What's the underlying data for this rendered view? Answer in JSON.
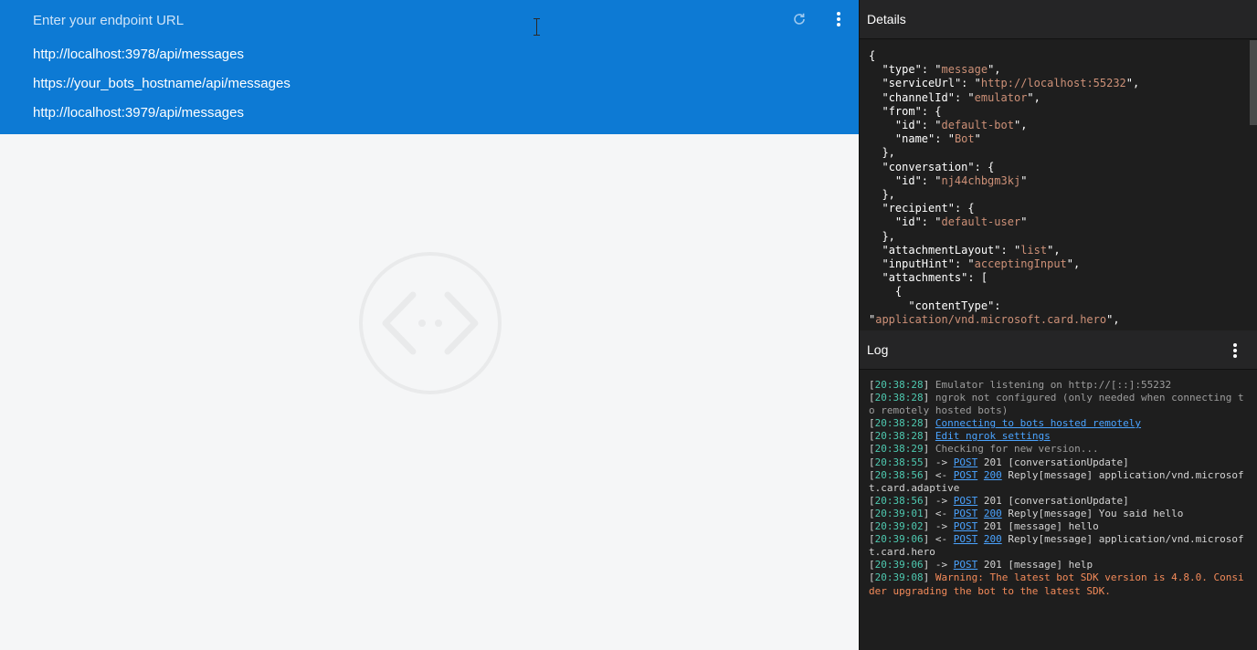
{
  "endpoint": {
    "placeholder": "Enter your endpoint URL",
    "suggestions": [
      "http://localhost:3978/api/messages",
      "https://your_bots_hostname/api/messages",
      "http://localhost:3979/api/messages"
    ]
  },
  "details": {
    "title": "Details",
    "json_lines": [
      [
        [
          "p",
          "{"
        ]
      ],
      [
        [
          "p",
          "  \""
        ],
        [
          "k",
          "type"
        ],
        [
          "p",
          "\": \""
        ],
        [
          "s",
          "message"
        ],
        [
          "p",
          "\","
        ]
      ],
      [
        [
          "p",
          "  \""
        ],
        [
          "k",
          "serviceUrl"
        ],
        [
          "p",
          "\": \""
        ],
        [
          "s",
          "http://localhost:55232"
        ],
        [
          "p",
          "\","
        ]
      ],
      [
        [
          "p",
          "  \""
        ],
        [
          "k",
          "channelId"
        ],
        [
          "p",
          "\": \""
        ],
        [
          "s",
          "emulator"
        ],
        [
          "p",
          "\","
        ]
      ],
      [
        [
          "p",
          "  \""
        ],
        [
          "k",
          "from"
        ],
        [
          "p",
          "\": {"
        ]
      ],
      [
        [
          "p",
          "    \""
        ],
        [
          "k",
          "id"
        ],
        [
          "p",
          "\": \""
        ],
        [
          "s",
          "default-bot"
        ],
        [
          "p",
          "\","
        ]
      ],
      [
        [
          "p",
          "    \""
        ],
        [
          "k",
          "name"
        ],
        [
          "p",
          "\": \""
        ],
        [
          "s",
          "Bot"
        ],
        [
          "p",
          "\""
        ]
      ],
      [
        [
          "p",
          "  },"
        ]
      ],
      [
        [
          "p",
          "  \""
        ],
        [
          "k",
          "conversation"
        ],
        [
          "p",
          "\": {"
        ]
      ],
      [
        [
          "p",
          "    \""
        ],
        [
          "k",
          "id"
        ],
        [
          "p",
          "\": \""
        ],
        [
          "s",
          "nj44chbgm3kj"
        ],
        [
          "p",
          "\""
        ]
      ],
      [
        [
          "p",
          "  },"
        ]
      ],
      [
        [
          "p",
          "  \""
        ],
        [
          "k",
          "recipient"
        ],
        [
          "p",
          "\": {"
        ]
      ],
      [
        [
          "p",
          "    \""
        ],
        [
          "k",
          "id"
        ],
        [
          "p",
          "\": \""
        ],
        [
          "s",
          "default-user"
        ],
        [
          "p",
          "\""
        ]
      ],
      [
        [
          "p",
          "  },"
        ]
      ],
      [
        [
          "p",
          "  \""
        ],
        [
          "k",
          "attachmentLayout"
        ],
        [
          "p",
          "\": \""
        ],
        [
          "s",
          "list"
        ],
        [
          "p",
          "\","
        ]
      ],
      [
        [
          "p",
          "  \""
        ],
        [
          "k",
          "inputHint"
        ],
        [
          "p",
          "\": \""
        ],
        [
          "s",
          "acceptingInput"
        ],
        [
          "p",
          "\","
        ]
      ],
      [
        [
          "p",
          "  \""
        ],
        [
          "k",
          "attachments"
        ],
        [
          "p",
          "\": ["
        ]
      ],
      [
        [
          "p",
          "    {"
        ]
      ],
      [
        [
          "p",
          "      \""
        ],
        [
          "k",
          "contentType"
        ],
        [
          "p",
          "\":"
        ]
      ],
      [
        [
          "p",
          "\""
        ],
        [
          "s",
          "application/vnd.microsoft.card.hero"
        ],
        [
          "p",
          "\","
        ]
      ]
    ]
  },
  "log": {
    "title": "Log",
    "entries": [
      {
        "time": "20:38:28",
        "parts": [
          [
            "dim",
            "Emulator listening on http://[::]:55232"
          ]
        ]
      },
      {
        "time": "20:38:28",
        "parts": [
          [
            "dim",
            "ngrok not configured (only needed when connecting to remotely hosted bots)"
          ]
        ]
      },
      {
        "time": "20:38:28",
        "parts": [
          [
            "lnk",
            "Connecting to bots hosted remotely"
          ]
        ]
      },
      {
        "time": "20:38:28",
        "parts": [
          [
            "lnk",
            "Edit ngrok settings"
          ]
        ]
      },
      {
        "time": "20:38:29",
        "parts": [
          [
            "dim",
            "Checking for new version..."
          ]
        ]
      },
      {
        "time": "20:38:55",
        "parts": [
          [
            "txt",
            "-> "
          ],
          [
            "lnk",
            "POST"
          ],
          [
            "txt",
            " 201 [conversationUpdate]"
          ]
        ]
      },
      {
        "time": "20:38:56",
        "parts": [
          [
            "txt",
            "<- "
          ],
          [
            "lnk",
            "POST"
          ],
          [
            "txt",
            " "
          ],
          [
            "lnk",
            "200"
          ],
          [
            "txt",
            " Reply[message] application/vnd.microsoft.card.adaptive"
          ]
        ]
      },
      {
        "time": "20:38:56",
        "parts": [
          [
            "txt",
            "-> "
          ],
          [
            "lnk",
            "POST"
          ],
          [
            "txt",
            " 201 [conversationUpdate]"
          ]
        ]
      },
      {
        "time": "20:39:01",
        "parts": [
          [
            "txt",
            "<- "
          ],
          [
            "lnk",
            "POST"
          ],
          [
            "txt",
            " "
          ],
          [
            "lnk",
            "200"
          ],
          [
            "txt",
            " Reply[message] You said hello"
          ]
        ]
      },
      {
        "time": "20:39:02",
        "parts": [
          [
            "txt",
            "-> "
          ],
          [
            "lnk",
            "POST"
          ],
          [
            "txt",
            " 201 [message] hello"
          ]
        ]
      },
      {
        "time": "20:39:06",
        "parts": [
          [
            "txt",
            "<- "
          ],
          [
            "lnk",
            "POST"
          ],
          [
            "txt",
            " "
          ],
          [
            "lnk",
            "200"
          ],
          [
            "txt",
            " Reply[message] application/vnd.microsoft.card.hero"
          ]
        ]
      },
      {
        "time": "20:39:06",
        "parts": [
          [
            "txt",
            "-> "
          ],
          [
            "lnk",
            "POST"
          ],
          [
            "txt",
            " 201 [message] help"
          ]
        ]
      },
      {
        "time": "20:39:08",
        "parts": [
          [
            "warn",
            "Warning: The latest bot SDK version is 4.8.0. Consider upgrading the bot to the latest SDK."
          ]
        ]
      }
    ]
  },
  "colors": {
    "url_bar": "#0d7ad4",
    "json_string": "#ce9178",
    "log_timestamp": "#4ec9b0",
    "log_link": "#4aa3ff",
    "log_warning": "#f48b5a"
  },
  "icons": {
    "refresh": "refresh-icon",
    "more": "more-vertical-icon",
    "emblem": "bot-emulator-emblem"
  }
}
